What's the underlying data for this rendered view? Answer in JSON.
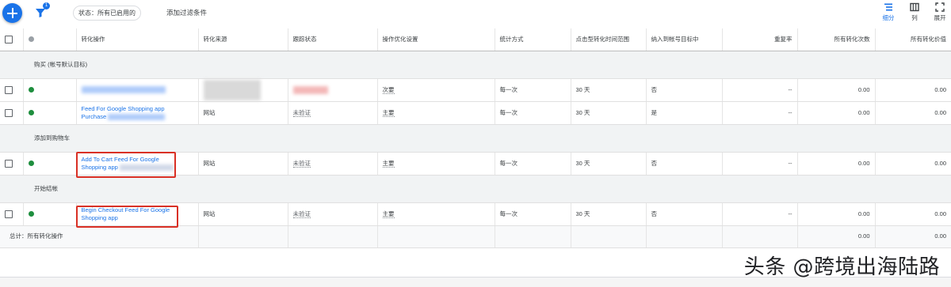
{
  "toolbar": {
    "filter_badge": "1",
    "status_chip": "状态：所有已启用的",
    "add_filter": "添加过滤条件",
    "tools": [
      {
        "label": "细分",
        "icon": "segment-icon",
        "active": true
      },
      {
        "label": "列",
        "icon": "columns-icon",
        "active": false
      },
      {
        "label": "展开",
        "icon": "expand-icon",
        "active": false
      }
    ]
  },
  "columns": [
    "转化操作",
    "转化来源",
    "跟踪状态",
    "操作优化设置",
    "统计方式",
    "点击型转化时间范围",
    "纳入到帐号目标中",
    "重复率",
    "所有转化次数",
    "所有转化价值"
  ],
  "sections": [
    {
      "title": "购买 (帐号默认目标)",
      "rows": [
        {
          "action": [
            "",
            ""
          ],
          "source": "",
          "tracking": "",
          "optimization": "次要",
          "counting": "每一次",
          "window": "30 天",
          "include": "否",
          "repeat": "--",
          "all_conv": "0.00",
          "all_value": "0.00"
        },
        {
          "action": [
            "Feed For Google Shopping app",
            "Purchase"
          ],
          "source": "网站",
          "tracking": "未验证",
          "optimization": "主要",
          "counting": "每一次",
          "window": "30 天",
          "include": "是",
          "repeat": "--",
          "all_conv": "0.00",
          "all_value": "0.00"
        }
      ]
    },
    {
      "title": "添加到购物车",
      "rows": [
        {
          "action": [
            "Add To Cart Feed For Google",
            "Shopping app"
          ],
          "source": "网站",
          "tracking": "未验证",
          "optimization": "主要",
          "counting": "每一次",
          "window": "30 天",
          "include": "否",
          "repeat": "--",
          "all_conv": "0.00",
          "all_value": "0.00"
        }
      ]
    },
    {
      "title": "开始结帐",
      "rows": [
        {
          "action": [
            "Begin Checkout Feed For Google",
            "Shopping app"
          ],
          "source": "网站",
          "tracking": "未验证",
          "optimization": "主要",
          "counting": "每一次",
          "window": "30 天",
          "include": "否",
          "repeat": "--",
          "all_conv": "0.00",
          "all_value": "0.00"
        }
      ]
    }
  ],
  "total": {
    "label": "总计：所有转化操作",
    "all_conv": "0.00",
    "all_value": "0.00"
  },
  "watermark": "头条 @跨境出海陆路",
  "colors": {
    "accent": "#1a73e8",
    "status_green": "#1e8e3e",
    "highlight_red": "#d93025"
  }
}
